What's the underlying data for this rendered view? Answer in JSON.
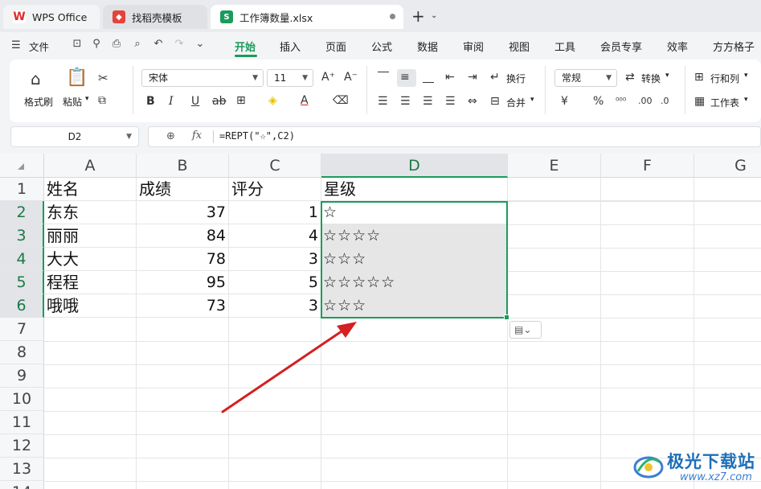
{
  "tabs": [
    {
      "label": "WPS Office",
      "icon": "wps-logo-icon"
    },
    {
      "label": "找稻壳模板",
      "icon": "daoke-icon"
    },
    {
      "label": "工作簿数量.xlsx",
      "icon": "sheet-s-icon"
    }
  ],
  "tabbar": {
    "new_tab": "+"
  },
  "menu": {
    "file": "文件",
    "items": [
      "开始",
      "插入",
      "页面",
      "公式",
      "数据",
      "审阅",
      "视图",
      "工具",
      "会员专享",
      "效率",
      "方方格子"
    ],
    "active": "开始"
  },
  "ribbon": {
    "format_painter": "格式刷",
    "paste": "粘贴",
    "font_name": "宋体",
    "font_size": "11",
    "wrap": "换行",
    "merge": "合并",
    "number_format": "常规",
    "convert": "转换",
    "rows_cols": "行和列",
    "worksheet": "工作表",
    "currency_symbol": "¥",
    "percent_symbol": "%"
  },
  "formula_bar": {
    "name_box": "D2",
    "fx_label": "fx",
    "formula": "=REPT(\"☆\",C2)"
  },
  "grid": {
    "columns": [
      "A",
      "B",
      "C",
      "D",
      "E",
      "F",
      "G"
    ],
    "row_numbers": [
      "1",
      "2",
      "3",
      "4",
      "5",
      "6",
      "7",
      "8",
      "9",
      "10",
      "11",
      "12",
      "13",
      "14"
    ],
    "header_row": [
      "姓名",
      "成绩",
      "评分",
      "星级"
    ],
    "rows": [
      {
        "name": "东东",
        "score": "37",
        "rating": "1",
        "stars": "☆"
      },
      {
        "name": "丽丽",
        "score": "84",
        "rating": "4",
        "stars": "☆☆☆☆"
      },
      {
        "name": "大大",
        "score": "78",
        "rating": "3",
        "stars": "☆☆☆"
      },
      {
        "name": "程程",
        "score": "95",
        "rating": "5",
        "stars": "☆☆☆☆☆"
      },
      {
        "name": "哦哦",
        "score": "73",
        "rating": "3",
        "stars": "☆☆☆"
      }
    ],
    "selected_column": "D",
    "selected_rows": [
      "2",
      "3",
      "4",
      "5",
      "6"
    ]
  },
  "watermark": {
    "title": "极光下载站",
    "url": "www.xz7.com"
  },
  "colors": {
    "accent": "#1a9b5c",
    "arrow": "#d42020",
    "selection_fill": "#e6e6e6"
  }
}
